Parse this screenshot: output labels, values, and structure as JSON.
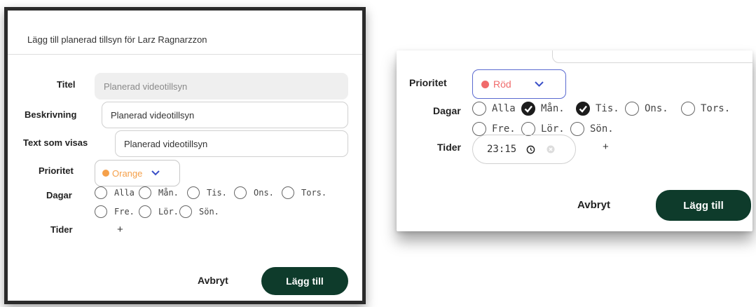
{
  "left_dialog": {
    "title": "Lägg till planerad tillsyn för Larz Ragnarzzon",
    "fields": {
      "titel": {
        "label": "Titel",
        "value": "Planerad videotillsyn"
      },
      "beskrivning": {
        "label": "Beskrivning",
        "value": "Planerad videotillsyn"
      },
      "text_som_visas": {
        "label": "Text som visas",
        "value": "Planerad videotillsyn"
      }
    },
    "prioritet": {
      "label": "Prioritet",
      "selected": "Orange",
      "color": "#f5a04a"
    },
    "dagar": {
      "label": "Dagar",
      "options": [
        {
          "label": "Alla",
          "checked": false
        },
        {
          "label": "Mån.",
          "checked": false
        },
        {
          "label": "Tis.",
          "checked": false
        },
        {
          "label": "Ons.",
          "checked": false
        },
        {
          "label": "Tors.",
          "checked": false
        },
        {
          "label": "Fre.",
          "checked": false
        },
        {
          "label": "Lör.",
          "checked": false
        },
        {
          "label": "Sön.",
          "checked": false
        }
      ]
    },
    "tider": {
      "label": "Tider",
      "add": "+"
    },
    "buttons": {
      "cancel": "Avbryt",
      "submit": "Lägg till"
    }
  },
  "right_dialog": {
    "prioritet": {
      "label": "Prioritet",
      "selected": "Röd",
      "color": "#f06b6b"
    },
    "dagar": {
      "label": "Dagar",
      "options": [
        {
          "label": "Alla",
          "checked": false
        },
        {
          "label": "Mån.",
          "checked": true
        },
        {
          "label": "Tis.",
          "checked": true
        },
        {
          "label": "Ons.",
          "checked": false
        },
        {
          "label": "Tors.",
          "checked": false
        },
        {
          "label": "Fre.",
          "checked": false
        },
        {
          "label": "Lör.",
          "checked": false
        },
        {
          "label": "Sön.",
          "checked": false
        }
      ]
    },
    "tider": {
      "label": "Tider",
      "time": "23:15",
      "add": "+"
    },
    "buttons": {
      "cancel": "Avbryt",
      "submit": "Lägg till"
    }
  },
  "colors": {
    "primary_button": "#0e3b2b",
    "select_border_active": "#5a6ad0",
    "chevron": "#3a4fc7"
  },
  "icons": {
    "select_chevron": "chevron-down-icon",
    "clock": "clock-icon",
    "clear": "clear-icon",
    "checked_radio": "check-icon"
  }
}
